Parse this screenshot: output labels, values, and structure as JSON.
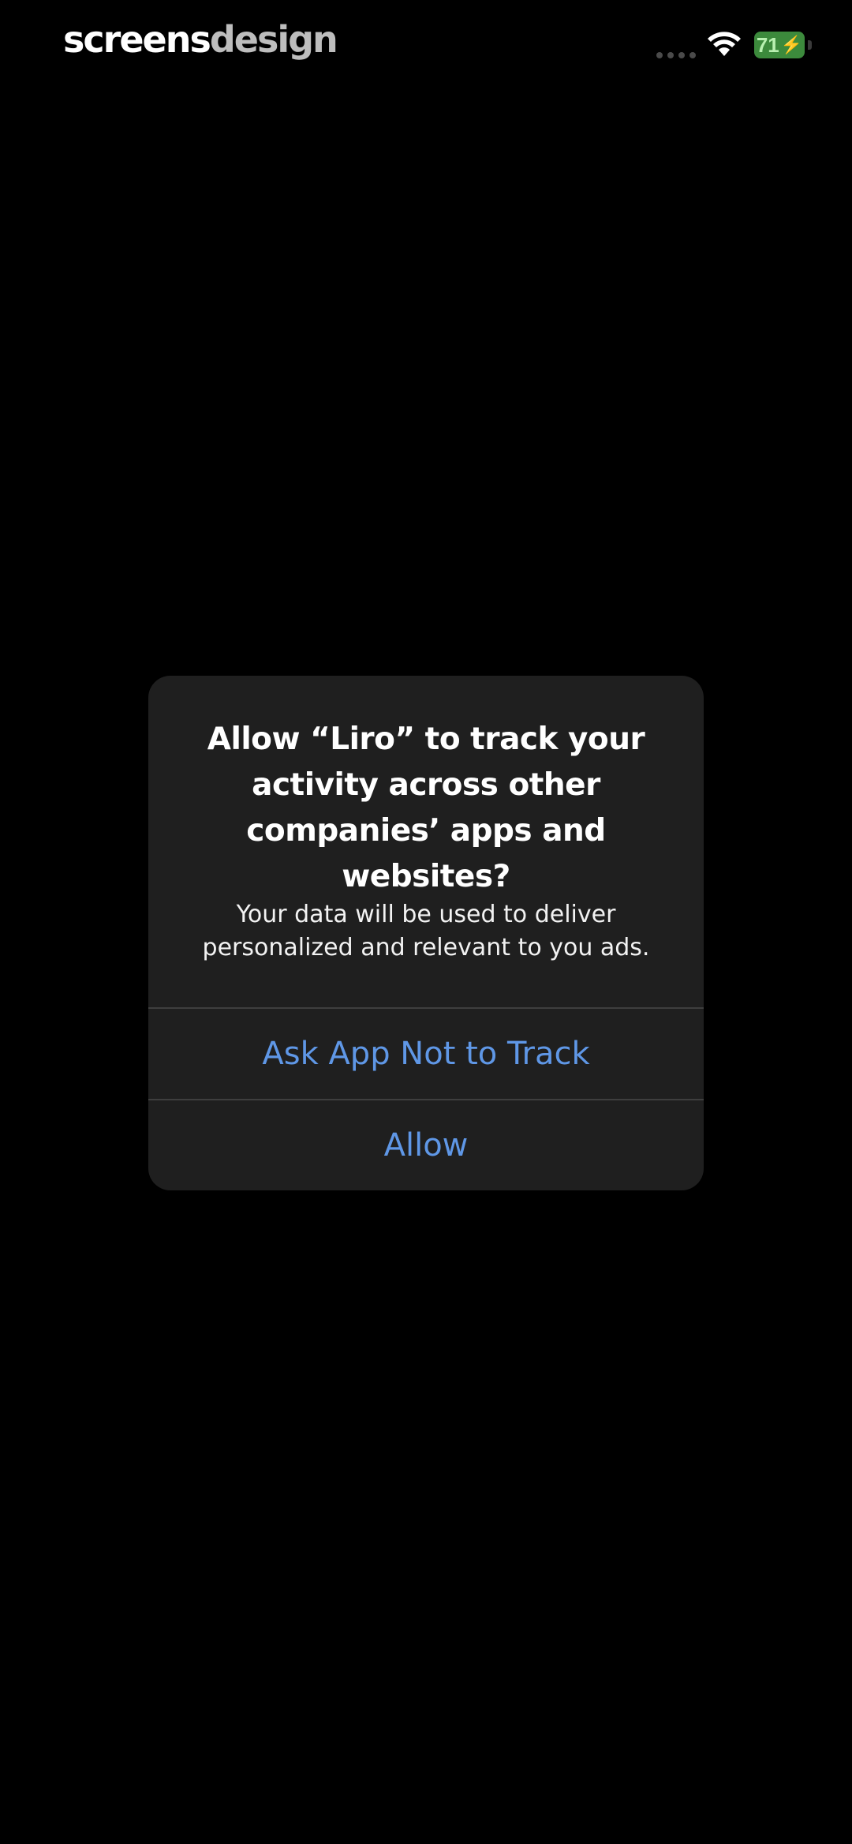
{
  "status_bar": {
    "brand_part1": "screens",
    "brand_part2": "design",
    "battery_level": "71",
    "battery_icon": "charging-bolt-icon",
    "wifi_icon": "wifi-icon",
    "battery_color": "#3c8a3c"
  },
  "alert": {
    "title": "Allow “Liro” to track your activity across other companies’ apps and websites?",
    "message": "Your data will be used to deliver personalized and relevant to you ads.",
    "buttons": [
      {
        "label": "Ask App Not to Track"
      },
      {
        "label": "Allow"
      }
    ],
    "button_color": "#5f97e6",
    "background_color": "#1f1f1f"
  }
}
